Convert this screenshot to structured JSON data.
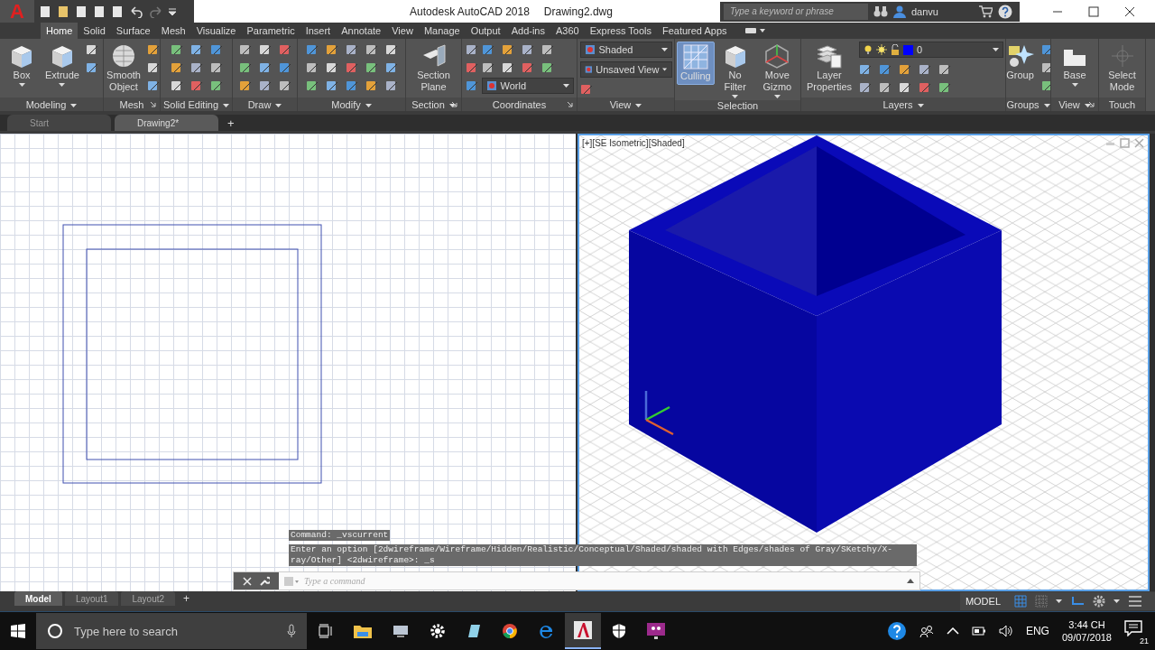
{
  "app_menu": {
    "label": "A"
  },
  "title": {
    "app": "Autodesk AutoCAD 2018",
    "file": "Drawing2.dwg"
  },
  "search": {
    "placeholder": "Type a keyword or phrase"
  },
  "user": {
    "name": "danvu"
  },
  "ribbon_tabs": [
    {
      "label": "Home",
      "selected": true
    },
    {
      "label": "Solid",
      "selected": false
    },
    {
      "label": "Surface",
      "selected": false
    },
    {
      "label": "Mesh",
      "selected": false
    },
    {
      "label": "Visualize",
      "selected": false
    },
    {
      "label": "Parametric",
      "selected": false
    },
    {
      "label": "Insert",
      "selected": false
    },
    {
      "label": "Annotate",
      "selected": false
    },
    {
      "label": "View",
      "selected": false
    },
    {
      "label": "Manage",
      "selected": false
    },
    {
      "label": "Output",
      "selected": false
    },
    {
      "label": "Add-ins",
      "selected": false
    },
    {
      "label": "A360",
      "selected": false
    },
    {
      "label": "Express Tools",
      "selected": false
    },
    {
      "label": "Featured Apps",
      "selected": false
    }
  ],
  "ribbon_panels": [
    {
      "title": "Modeling",
      "menu": true,
      "launcher": false,
      "items": [
        {
          "kind": "large",
          "label": "Box",
          "on": false,
          "dropdown": true
        },
        {
          "kind": "large",
          "label": "Extrude",
          "on": false,
          "dropdown": true
        },
        {
          "kind": "tools"
        }
      ]
    },
    {
      "title": "Mesh",
      "menu": false,
      "launcher": true,
      "items": [
        {
          "kind": "large",
          "label": "Smooth Object",
          "on": false,
          "dropdown": false
        },
        {
          "kind": "tools"
        }
      ]
    },
    {
      "title": "Solid Editing",
      "menu": true,
      "launcher": false,
      "items": [
        {
          "kind": "tools"
        }
      ]
    },
    {
      "title": "Draw",
      "menu": true,
      "launcher": false,
      "items": [
        {
          "kind": "tools"
        }
      ]
    },
    {
      "title": "Modify",
      "menu": true,
      "launcher": false,
      "items": [
        {
          "kind": "tools"
        }
      ]
    },
    {
      "title": "Section",
      "menu": true,
      "launcher": true,
      "items": [
        {
          "kind": "large",
          "label": "Section Plane",
          "on": false,
          "dropdown": false
        }
      ]
    },
    {
      "title": "Coordinates",
      "menu": false,
      "launcher": true,
      "items": [
        {
          "kind": "tools"
        },
        {
          "kind": "stack",
          "items": [
            {
              "kind": "tools"
            },
            {
              "kind": "combo",
              "value": "World"
            }
          ]
        }
      ]
    },
    {
      "title": "View",
      "menu": true,
      "launcher": false,
      "items": [
        {
          "kind": "stack",
          "items": [
            {
              "kind": "combo",
              "value": "Shaded"
            },
            {
              "kind": "combo",
              "value": "Unsaved View"
            },
            {
              "kind": "tools"
            }
          ]
        }
      ]
    },
    {
      "title": "Selection",
      "menu": false,
      "launcher": false,
      "items": [
        {
          "kind": "large",
          "label": "Culling",
          "on": true,
          "dropdown": false
        },
        {
          "kind": "large",
          "label": "No Filter",
          "on": false,
          "dropdown": true
        },
        {
          "kind": "large",
          "label": "Move Gizmo",
          "on": false,
          "dropdown": true
        }
      ]
    },
    {
      "title": "Layers",
      "menu": true,
      "launcher": false,
      "items": [
        {
          "kind": "large",
          "label": "Layer Properties",
          "on": false,
          "dropdown": false
        },
        {
          "kind": "stack",
          "items": [
            {
              "kind": "layer",
              "value": "0",
              "color": "#0000ff"
            },
            {
              "kind": "tools"
            }
          ]
        }
      ]
    },
    {
      "title": "Groups",
      "menu": true,
      "launcher": false,
      "items": [
        {
          "kind": "large",
          "label": "Group",
          "on": false,
          "dropdown": false
        },
        {
          "kind": "tools"
        }
      ]
    },
    {
      "title": "View",
      "menu": true,
      "launcher": true,
      "items": [
        {
          "kind": "large",
          "label": "Base",
          "on": false,
          "dropdown": true
        }
      ]
    },
    {
      "title": "Touch",
      "menu": false,
      "launcher": false,
      "items": [
        {
          "kind": "large",
          "label": "Select Mode",
          "on": false,
          "dropdown": false
        }
      ]
    }
  ],
  "file_tabs": [
    {
      "label": "Start",
      "selected": false,
      "closable": false
    },
    {
      "label": "Drawing2*",
      "selected": true,
      "closable": true
    }
  ],
  "new_tab": "+",
  "viewports": [
    {
      "kind": "plan",
      "active": false
    },
    {
      "kind": "iso",
      "label": "[+][SE Isometric][Shaded]",
      "active": true
    }
  ],
  "command_line": {
    "history": [
      "Command: _vscurrent",
      "Enter an option [2dwireframe/Wireframe/Hidden/Realistic/Conceptual/Shaded/shaded with Edges/shades of Gray/SKetchy/X-ray/Other] <2dwireframe>: _s"
    ],
    "placeholder": "Type a command"
  },
  "layout_tabs": [
    {
      "label": "Model",
      "selected": true
    },
    {
      "label": "Layout1",
      "selected": false
    },
    {
      "label": "Layout2",
      "selected": false
    }
  ],
  "new_layout": "+",
  "status_bar": {
    "mode": "MODEL"
  },
  "taskbar": {
    "search_placeholder": "Type here to search",
    "language": "ENG",
    "time": "3:44 CH",
    "date": "09/07/2018",
    "notifications": "21"
  }
}
